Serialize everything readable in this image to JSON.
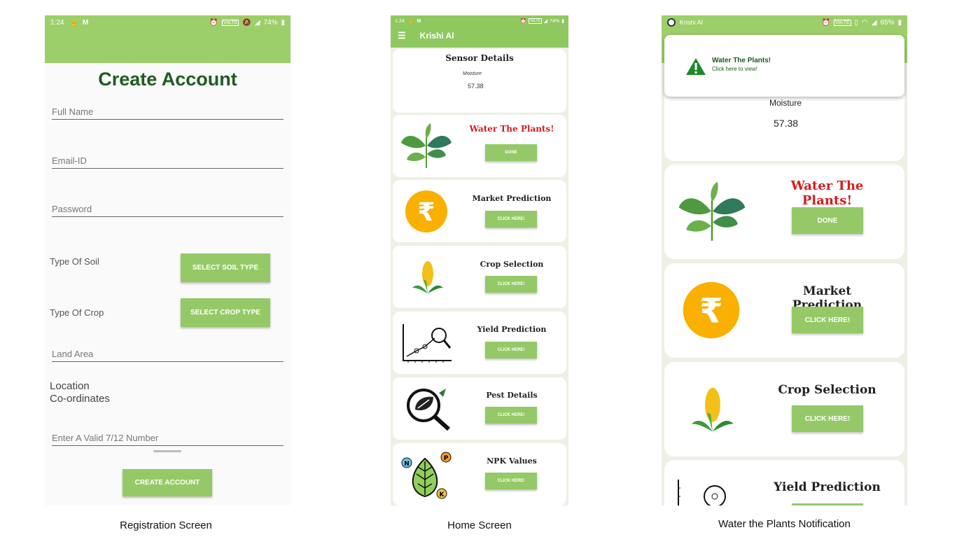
{
  "registration": {
    "status": {
      "time": "1:24",
      "battery": "74%",
      "volte": "VoLTE"
    },
    "title": "Create Account",
    "fields": {
      "full_name": "Full Name",
      "email": "Email-ID",
      "password": "Password",
      "land_area": "Land Area",
      "number": "Enter A Valid 7/12 Number"
    },
    "soil_label": "Type Of Soil",
    "soil_button": "SELECT SOIL TYPE",
    "crop_label": "Type Of Crop",
    "crop_button": "SELECT CROP TYPE",
    "location_label_1": "Location",
    "location_label_2": "Co-ordinates",
    "create_button": "CREATE ACCOUNT",
    "caption": "Registration Screen"
  },
  "home": {
    "status": {
      "time": "1:24",
      "battery": "74%",
      "volte": "VoLTE"
    },
    "app_title": "Krishi AI",
    "sensor": {
      "title": "Sensor Details",
      "label": "Moisture",
      "value": "57.38"
    },
    "cards": [
      {
        "title": "Water The Plants!",
        "button": "DONE",
        "icon": "plant-icon"
      },
      {
        "title": "Market Prediction",
        "button": "CLICK HERE!",
        "icon": "rupee-icon"
      },
      {
        "title": "Crop Selection",
        "button": "CLICK HERE!",
        "icon": "corn-icon"
      },
      {
        "title": "Yield Prediction",
        "button": "CLICK HERE!",
        "icon": "yield-chart-icon"
      },
      {
        "title": "Pest Details",
        "button": "CLICK HERE!",
        "icon": "pest-search-icon"
      },
      {
        "title": "NPK Values",
        "button": "CLICK HERE!",
        "icon": "npk-leaf-icon"
      }
    ],
    "caption": "Home Screen"
  },
  "notification": {
    "status": {
      "app": "Krishi AI",
      "battery": "65%",
      "volte": "VoLTE"
    },
    "notif_title": "Water The Plants!",
    "notif_sub": "Click here to view!",
    "sensor": {
      "label": "Moisture",
      "value": "57.38"
    },
    "cards": [
      {
        "title": "Water The Plants!",
        "button": "DONE"
      },
      {
        "title": "Market Prediction",
        "button": "CLICK HERE!"
      },
      {
        "title": "Crop Selection",
        "button": "CLICK HERE!"
      },
      {
        "title": "Yield Prediction",
        "button": ""
      }
    ],
    "caption": "Water the Plants Notification"
  },
  "colors": {
    "accent": "#95c967",
    "title_green": "#1f5c20",
    "alert_red": "#d71c1c",
    "rupee": "#f9b000"
  }
}
